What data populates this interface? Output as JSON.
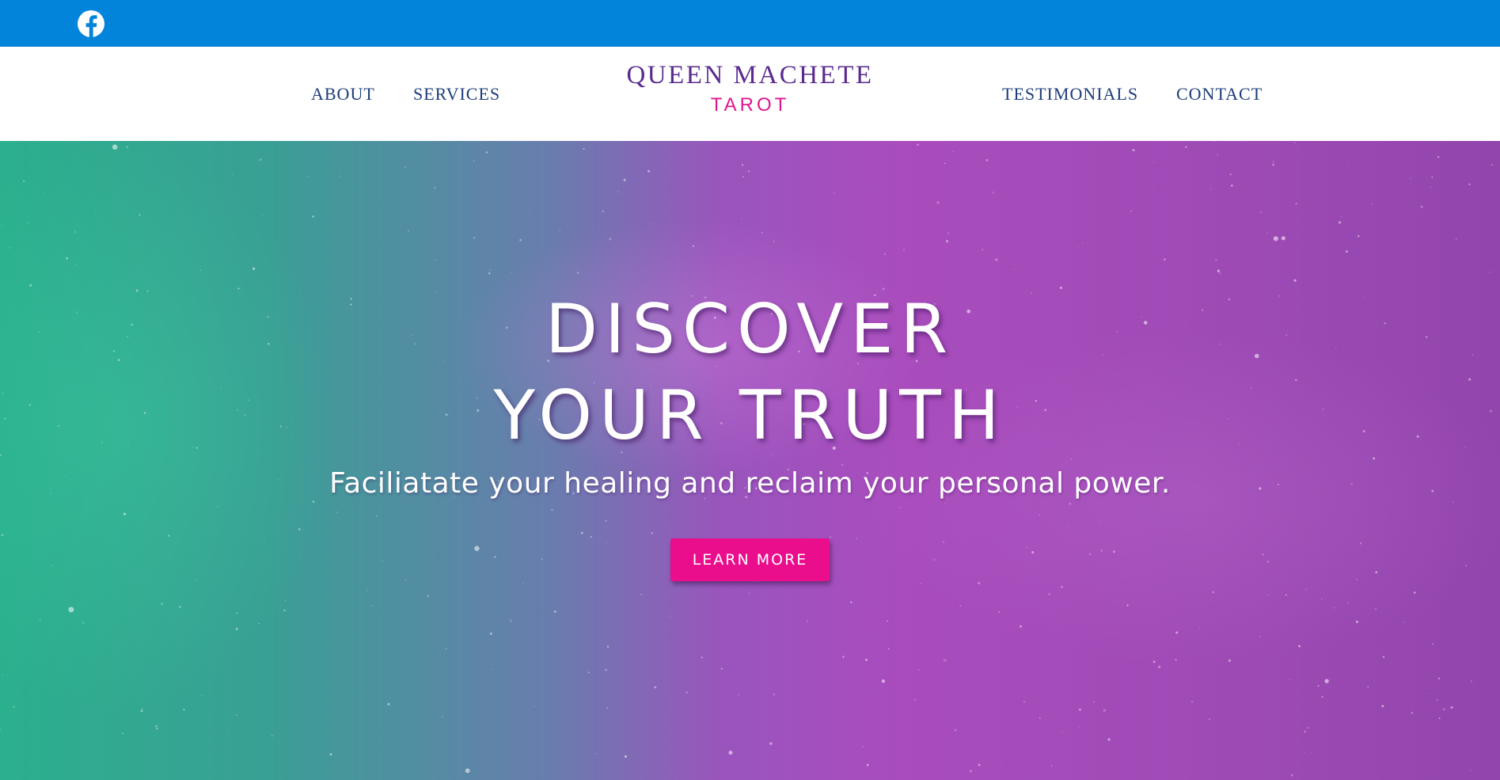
{
  "topbar": {
    "social_icon": "facebook-icon",
    "color": "#0384db"
  },
  "nav": {
    "left_links": [
      "ABOUT",
      "SERVICES"
    ],
    "right_links": [
      "TESTIMONIALS",
      "CONTACT"
    ],
    "link_color": "#1d3d7a"
  },
  "logo": {
    "line1": "QUEEN MACHETE",
    "line2": "TAROT",
    "line1_color": "#5a2a8e",
    "line2_color": "#e0168e"
  },
  "hero": {
    "headline_line1": "DISCOVER",
    "headline_line2": "YOUR TRUTH",
    "subheadline": "Faciliatate your healing and reclaim your personal power.",
    "cta_label": "LEARN MORE",
    "cta_color": "#ea0d8c",
    "gradient_colors": [
      "#2bb08d",
      "#6a7cae",
      "#a94cbd",
      "#9245ad"
    ]
  }
}
